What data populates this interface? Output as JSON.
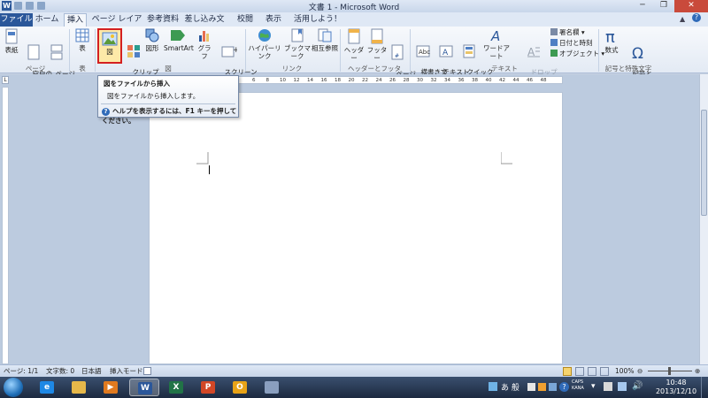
{
  "window": {
    "title": "文書 1 - Microsoft Word",
    "app_icon": "W"
  },
  "tabs": [
    {
      "label": "ファイル"
    },
    {
      "label": "ホーム"
    },
    {
      "label": "挿入"
    },
    {
      "label": "ページ レイアウト"
    },
    {
      "label": "参考資料"
    },
    {
      "label": "差し込み文書"
    },
    {
      "label": "校閲"
    },
    {
      "label": "表示"
    },
    {
      "label": "活用しよう！ワード"
    }
  ],
  "ribbon": {
    "page": {
      "cover": "表紙",
      "blank": "空白の\nページ",
      "break": "ページ\n区切り",
      "group": "ページ"
    },
    "table": {
      "table": "表",
      "group": "表"
    },
    "illustrations": {
      "picture": "図",
      "clipart": "クリップ\nアート",
      "shapes": "図形",
      "smartart": "SmartArt",
      "chart": "グラフ",
      "screenshot": "スクリーン\nショット",
      "group": "図"
    },
    "links": {
      "hyperlink": "ハイパーリンク",
      "bookmark": "ブックマーク",
      "crossref": "相互参照",
      "group": "リンク"
    },
    "header_footer": {
      "header": "ヘッダー",
      "footer": "フッター",
      "page_number": "ページ\n番号",
      "group": "ヘッダーとフッター"
    },
    "text": {
      "textbox": "横書き文\n字",
      "textbox2": "テキスト\nボックス",
      "quickparts": "クイック\nパーツ",
      "wordart": "ワードアート",
      "dropcap": "ドロップ\nキャップ",
      "signature": "署名欄",
      "datetime": "日付と時刻",
      "object": "オブジェクト",
      "group": "テキスト"
    },
    "symbols": {
      "equation": "数式",
      "symbol": "記号と\n特殊文字",
      "group": "記号と特殊文字"
    }
  },
  "tooltip": {
    "title": "図をファイルから挿入",
    "description": "図をファイルから挿入します。",
    "help": "ヘルプを表示するには、F1 キーを押してください。"
  },
  "ruler_numbers": [
    "6",
    "8",
    "10",
    "12",
    "14",
    "16",
    "18",
    "20",
    "22",
    "24",
    "26",
    "28",
    "30",
    "32",
    "34",
    "36",
    "38",
    "40",
    "42",
    "44",
    "46",
    "48"
  ],
  "statusbar": {
    "page": "ページ: 1/1",
    "words": "文字数: 0",
    "language": "日本語",
    "mode": "挿入モード",
    "zoom": "100%"
  },
  "taskbar": {
    "ime": "あ 般",
    "caps": "CAPS\nKANA",
    "time": "10:48",
    "date": "2013/12/10"
  }
}
